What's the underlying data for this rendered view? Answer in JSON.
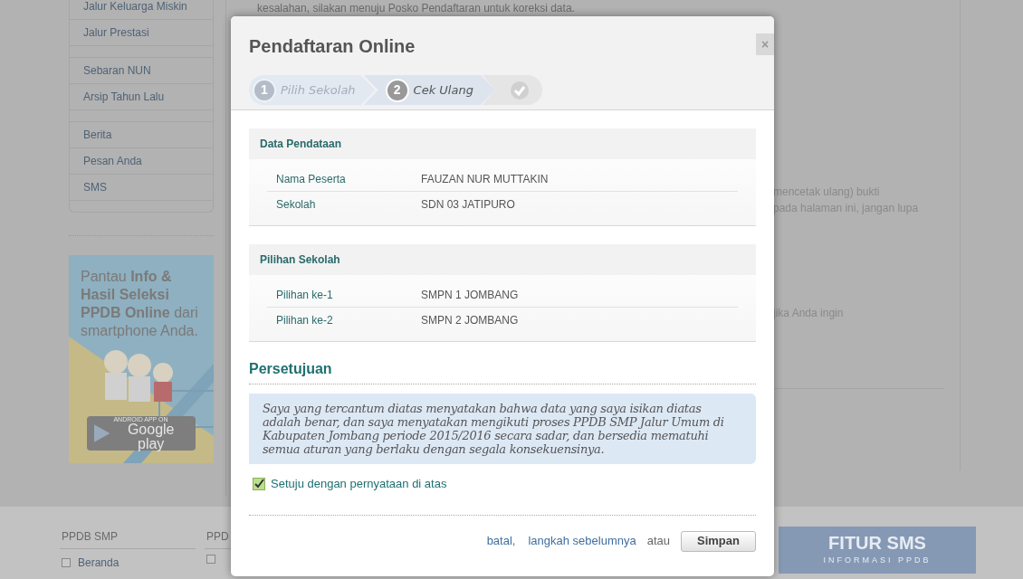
{
  "background": {
    "notice_fragment": "kesalahan, silakan menuju Posko Pendaftaran untuk koreksi data.",
    "sidebar_menu": [
      [
        "Jalur Keluarga Miskin",
        "Jalur Prestasi"
      ],
      [
        "Sebaran NUN",
        "Arsip Tahun Lalu"
      ],
      [
        "Berita",
        "Pesan Anda",
        "SMS"
      ]
    ],
    "banner": {
      "text": "Pantau **Info &** **Hasil Seleksi** **PPDB Online** dari smartphone Anda.",
      "badge_caption": "ANDROID APP ON",
      "badge_label": "Google play"
    },
    "content_fragments": [
      "mencetak ulang) bukti",
      "pada halaman ini, jangan lupa",
      "jika Anda ingin"
    ],
    "footer_columns": [
      {
        "title": "PPDB SMP",
        "items": [
          {
            "label": "Beranda",
            "checked": false
          }
        ]
      },
      {
        "title": "PPD",
        "items": [
          {
            "checked": false
          }
        ]
      }
    ],
    "sms_badge": {
      "title": "FITUR SMS",
      "subtitle": "INFORMASI PPDB"
    }
  },
  "modal": {
    "title": "Pendaftaran Online",
    "close": "×",
    "steps": [
      {
        "kind": "numbered",
        "number": "1",
        "label": "Pilih Sekolah",
        "selected": false
      },
      {
        "kind": "numbered",
        "number": "2",
        "label": "Cek Ulang",
        "selected": true
      },
      {
        "kind": "final",
        "selected": false
      }
    ],
    "sections": [
      {
        "title": "Data Pendataan",
        "rows": [
          {
            "label": "Nama Peserta",
            "value": "FAUZAN NUR MUTTAKIN"
          },
          {
            "label": "Sekolah",
            "value": "SDN 03 JATIPURO"
          }
        ]
      },
      {
        "title": "Pilihan Sekolah",
        "rows": [
          {
            "label": "Pilihan ke-1",
            "value": "SMPN 1 JOMBANG"
          },
          {
            "label": "Pilihan ke-2",
            "value": "SMPN 2 JOMBANG"
          }
        ]
      }
    ],
    "agreement": {
      "title": "Persetujuan",
      "statement": "Saya yang tercantum diatas menyatakan bahwa data yang saya isikan diatas adalah benar, dan saya menyatakan mengikuti proses PPDB SMP Jalur Umum di Kabupaten Jombang periode 2015/2016 secara sadar, dan bersedia mematuhi semua aturan yang berlaku dengan segala konsekuensinya.",
      "checkbox": {
        "label": "Setuju dengan pernyataan di atas",
        "checked": true
      }
    },
    "actions": {
      "cancel": "batal,",
      "back": "langkah sebelumnya",
      "separator": "atau",
      "submit": "Simpan"
    }
  }
}
